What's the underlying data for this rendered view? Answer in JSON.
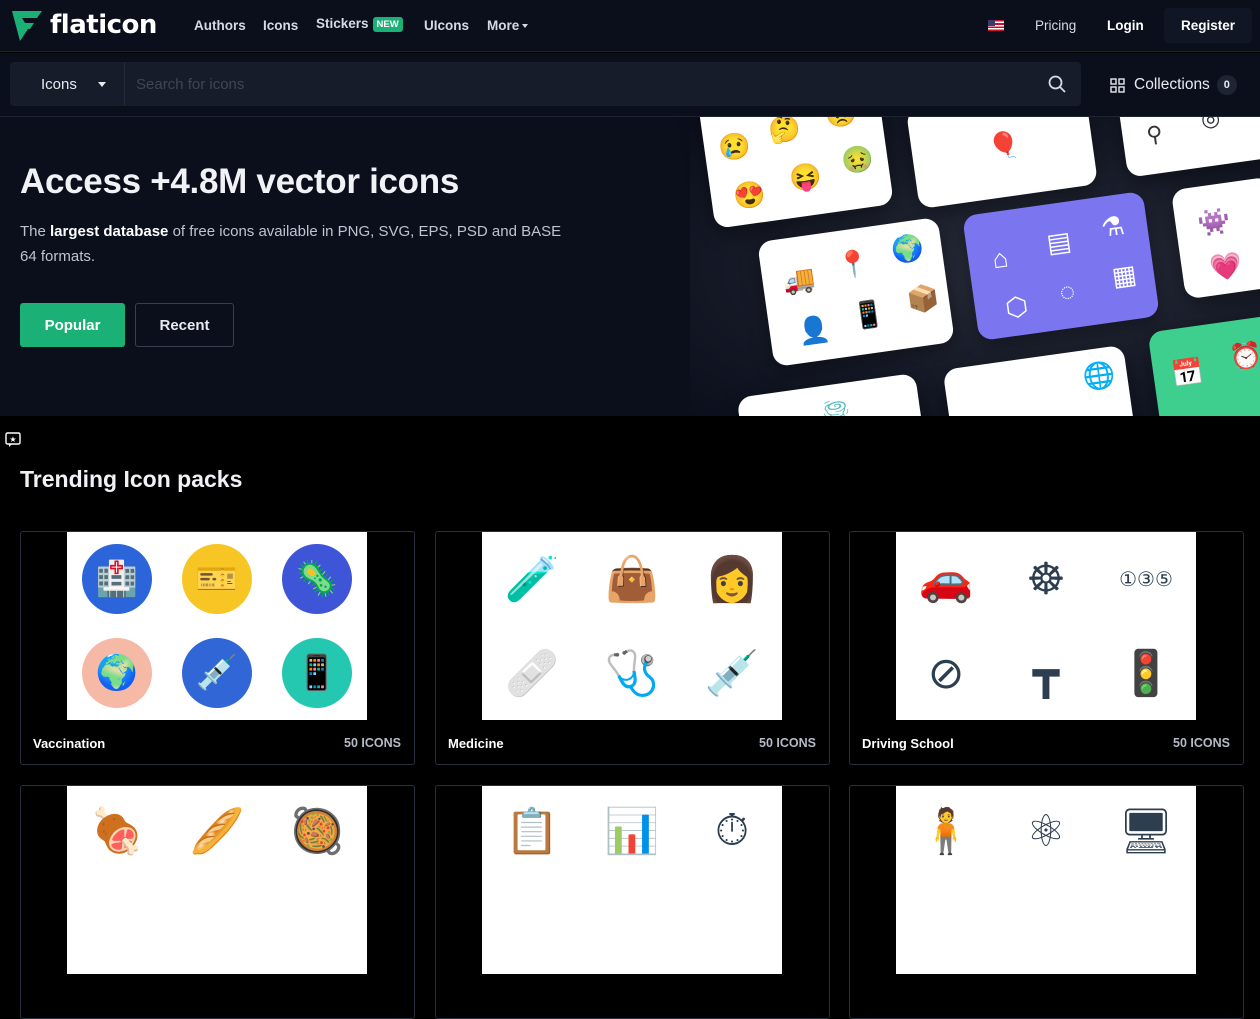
{
  "brand": {
    "name": "flaticon",
    "color": "#1bb075"
  },
  "nav": {
    "links": [
      "Authors",
      "Icons",
      "Stickers",
      "UIcons",
      "More"
    ],
    "new_badge": "NEW",
    "pricing": "Pricing",
    "login": "Login",
    "register": "Register"
  },
  "search": {
    "type": "Icons",
    "placeholder": "Search for icons",
    "collections_label": "Collections",
    "collections_count": "0"
  },
  "hero": {
    "title": "Access +4.8M vector icons",
    "sub_pre": "The ",
    "sub_bold": "largest database",
    "sub_post": " of free icons available in PNG, SVG, EPS, PSD and BASE 64 formats.",
    "popular": "Popular",
    "recent": "Recent"
  },
  "trending": {
    "title": "Trending Icon packs",
    "packs": [
      {
        "name": "Vaccination",
        "count": "50 ICONS"
      },
      {
        "name": "Medicine",
        "count": "50 ICONS"
      },
      {
        "name": "Driving School",
        "count": "50 ICONS"
      },
      {
        "name": "",
        "count": ""
      },
      {
        "name": "",
        "count": ""
      },
      {
        "name": "",
        "count": ""
      }
    ]
  }
}
